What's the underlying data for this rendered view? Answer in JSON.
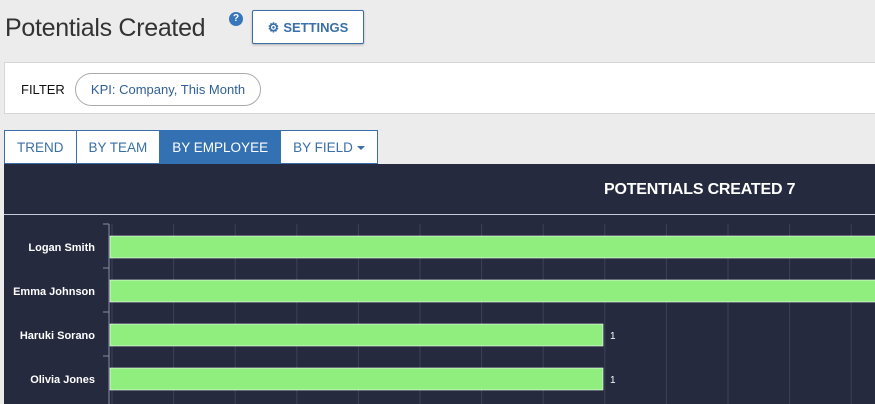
{
  "header": {
    "title": "Potentials Created",
    "help_icon": "question-circle-icon",
    "settings_label": "SETTINGS",
    "settings_icon": "gear-icon"
  },
  "filter": {
    "label": "FILTER",
    "chip": "KPI: Company, This Month"
  },
  "tabs": [
    {
      "label": "TREND",
      "active": false
    },
    {
      "label": "BY TEAM",
      "active": false
    },
    {
      "label": "BY EMPLOYEE",
      "active": true
    },
    {
      "label": "BY FIELD",
      "active": false,
      "dropdown": true
    }
  ],
  "colors": {
    "accent": "#3471b3",
    "chart_background": "#252a3f",
    "bar": "#90ee7e"
  },
  "chart_data": {
    "type": "bar",
    "orientation": "horizontal",
    "title": "POTENTIALS CREATED 7",
    "categories": [
      "Logan Smith",
      "Emma Johnson",
      "Haruki Sorano",
      "Olivia Jones"
    ],
    "values": [
      2,
      2,
      1,
      1
    ],
    "data_labels": [
      "",
      "",
      "1",
      "1"
    ],
    "xlim": [
      0,
      1.25
    ],
    "grid": true
  }
}
